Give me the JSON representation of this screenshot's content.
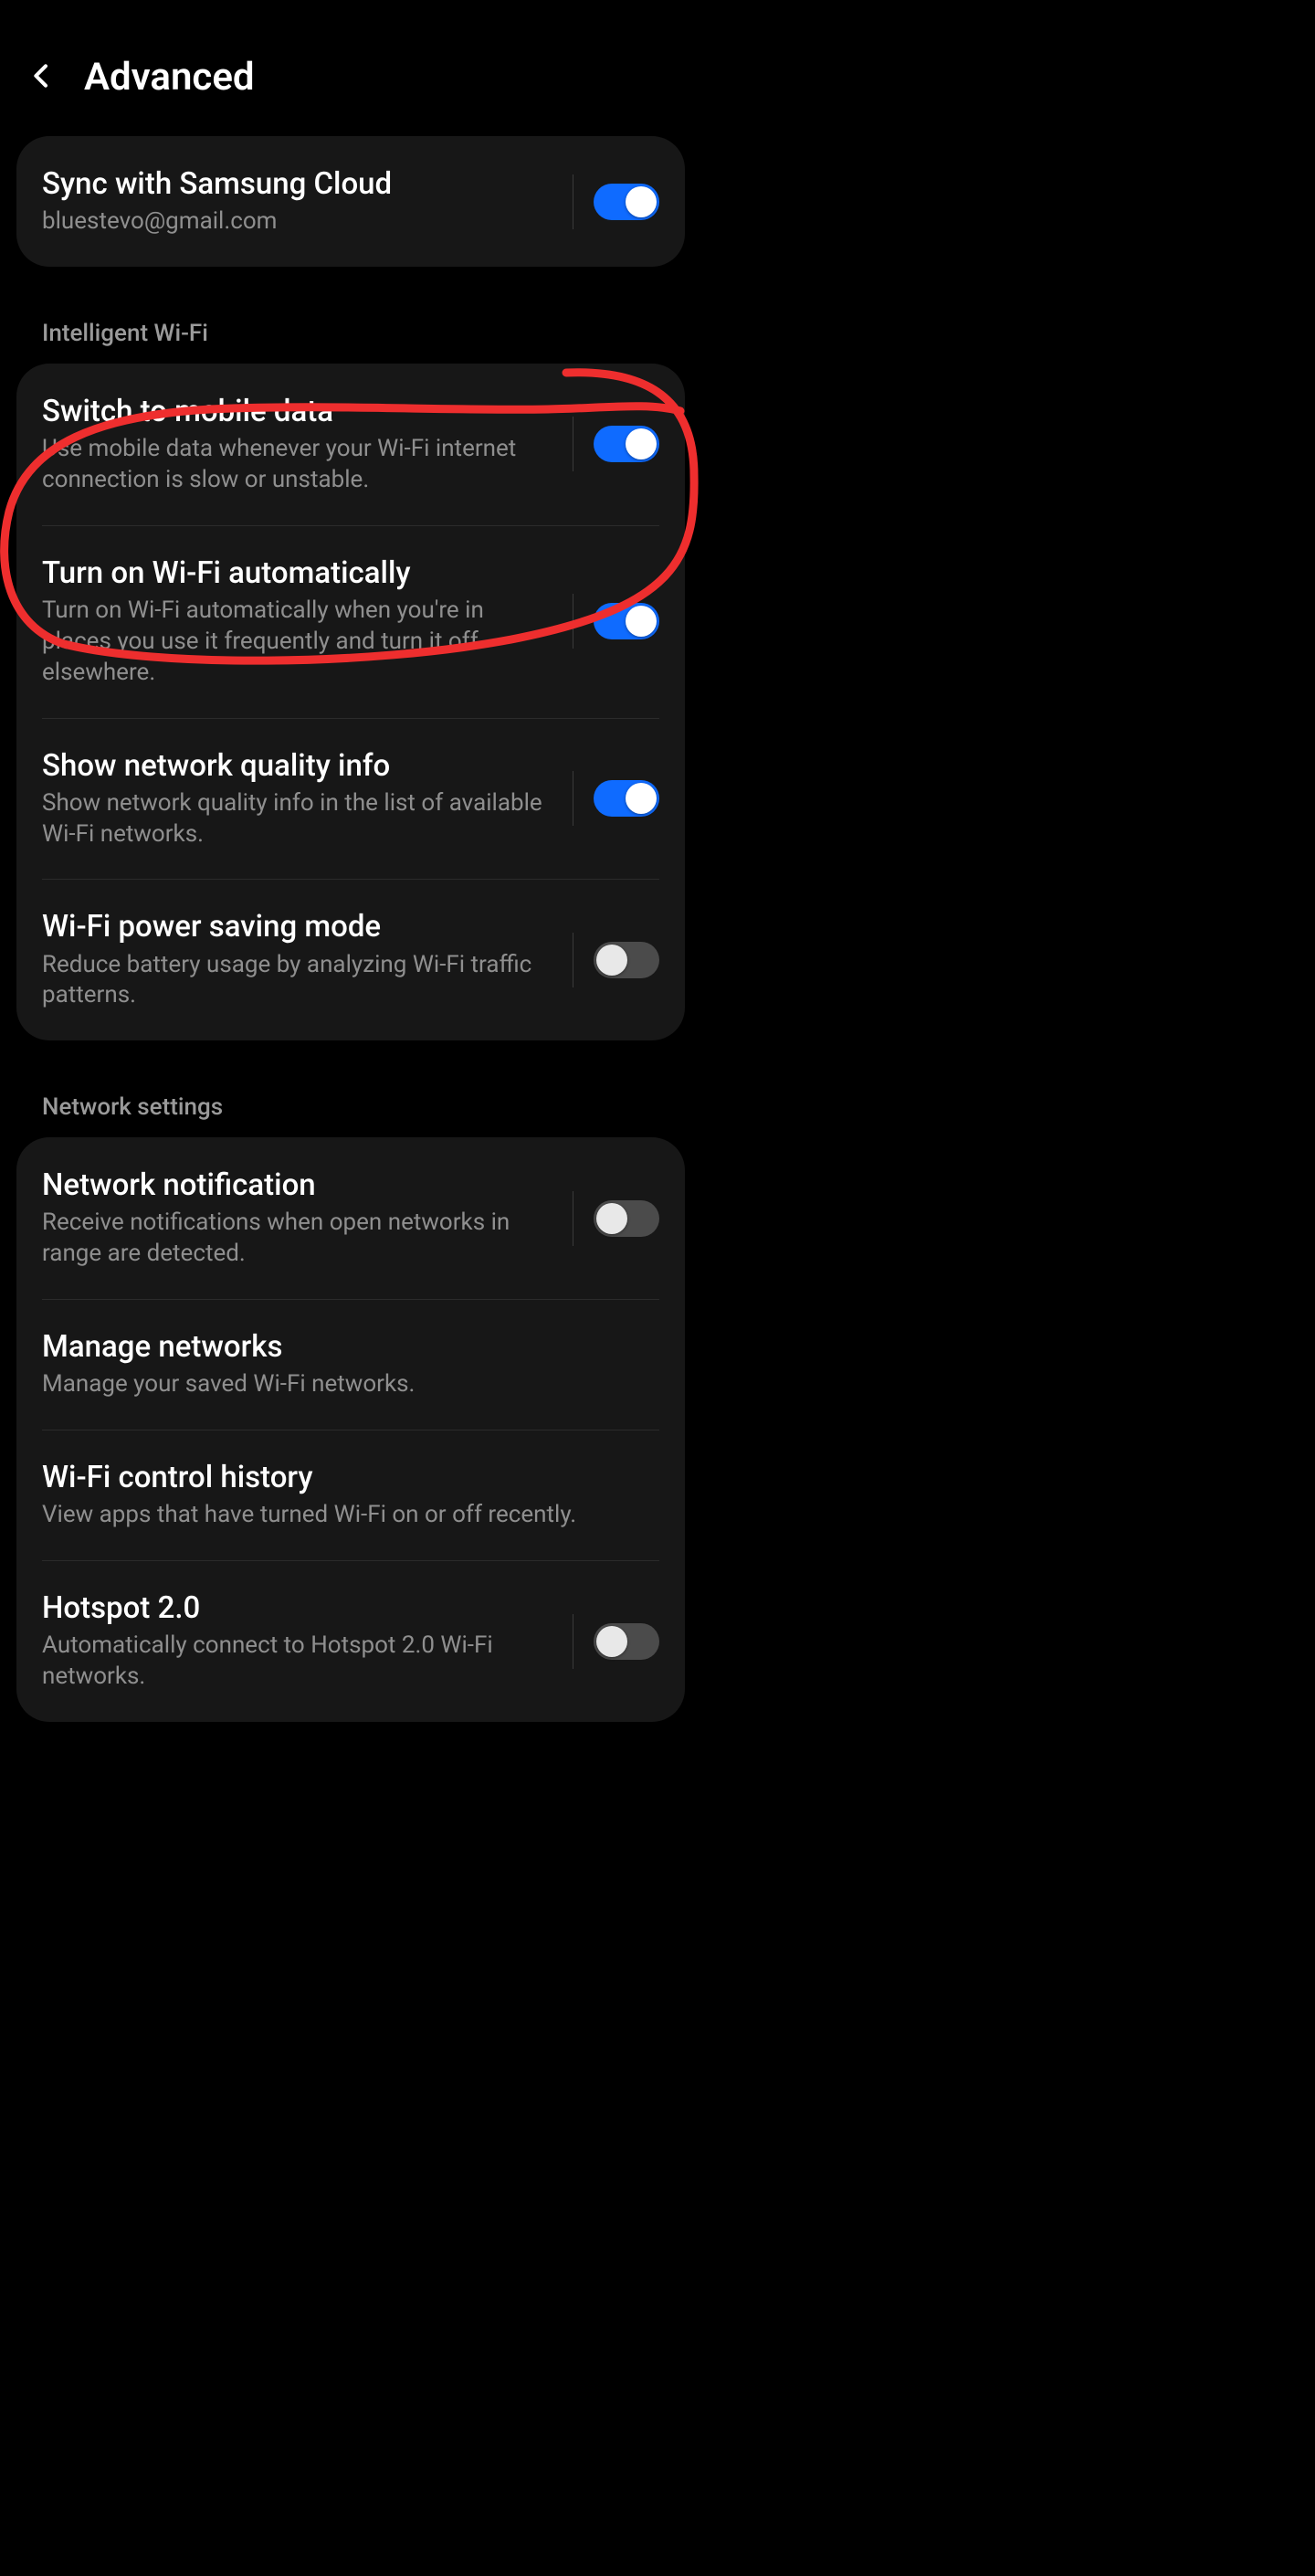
{
  "header": {
    "title": "Advanced"
  },
  "cloud": {
    "title": "Sync with Samsung Cloud",
    "subtitle": "bluestevo@gmail.com",
    "enabled": true
  },
  "sections": {
    "intelligent": {
      "label": "Intelligent Wi-Fi",
      "items": [
        {
          "title": "Switch to mobile data",
          "subtitle": "Use mobile data whenever your Wi-Fi internet connection is slow or unstable.",
          "enabled": true
        },
        {
          "title": "Turn on Wi-Fi automatically",
          "subtitle": "Turn on Wi-Fi automatically when you're in places you use it frequently and turn it off elsewhere.",
          "enabled": true
        },
        {
          "title": "Show network quality info",
          "subtitle": "Show network quality info in the list of available Wi-Fi networks.",
          "enabled": true
        },
        {
          "title": "Wi-Fi power saving mode",
          "subtitle": "Reduce battery usage by analyzing Wi-Fi traffic patterns.",
          "enabled": false
        }
      ]
    },
    "network": {
      "label": "Network settings",
      "items": [
        {
          "title": "Network notification",
          "subtitle": "Receive notifications when open networks in range are detected.",
          "enabled": false
        },
        {
          "title": "Manage networks",
          "subtitle": "Manage your saved Wi-Fi networks.",
          "enabled": null
        },
        {
          "title": "Wi-Fi control history",
          "subtitle": "View apps that have turned Wi-Fi on or off recently.",
          "enabled": null
        },
        {
          "title": "Hotspot 2.0",
          "subtitle": "Automatically connect to Hotspot 2.0 Wi-Fi networks.",
          "enabled": false
        }
      ]
    }
  },
  "annotation": {
    "target": "Turn on Wi-Fi automatically",
    "color": "#ee2e2e"
  }
}
